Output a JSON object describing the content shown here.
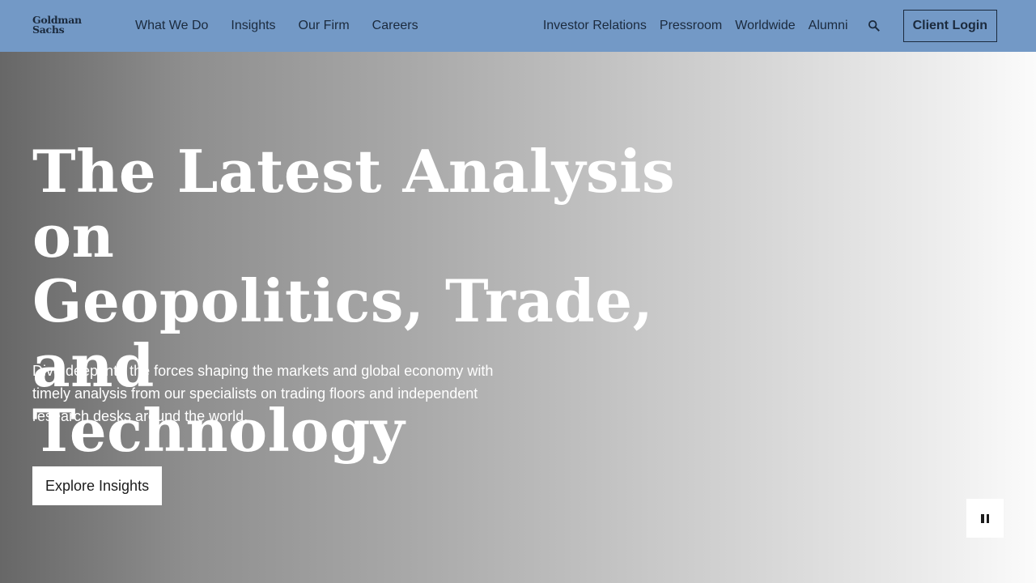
{
  "brand": {
    "logo_line1": "Goldman",
    "logo_line2": "Sachs"
  },
  "primary_nav": {
    "items": [
      {
        "label": "What We Do"
      },
      {
        "label": "Insights"
      },
      {
        "label": "Our Firm"
      },
      {
        "label": "Careers"
      }
    ]
  },
  "secondary_nav": {
    "items": [
      {
        "label": "Investor Relations"
      },
      {
        "label": "Pressroom"
      },
      {
        "label": "Worldwide"
      },
      {
        "label": "Alumni"
      }
    ],
    "search_icon": "search-icon",
    "client_login_label": "Client Login"
  },
  "hero": {
    "title_line1": "The Latest Analysis on",
    "title_line2": "Geopolitics, Trade, and",
    "title_line3": "Technology",
    "subtitle": "Dive deep into the forces shaping the markets and global economy with timely analysis from our specialists on trading floors and independent research desks around the world.",
    "cta_label": "Explore Insights",
    "pause_icon": "pause-icon"
  },
  "colors": {
    "header_bg": "#7399c6",
    "nav_text": "#1b2a3d",
    "hero_text": "#ffffff",
    "button_bg": "#ffffff"
  }
}
